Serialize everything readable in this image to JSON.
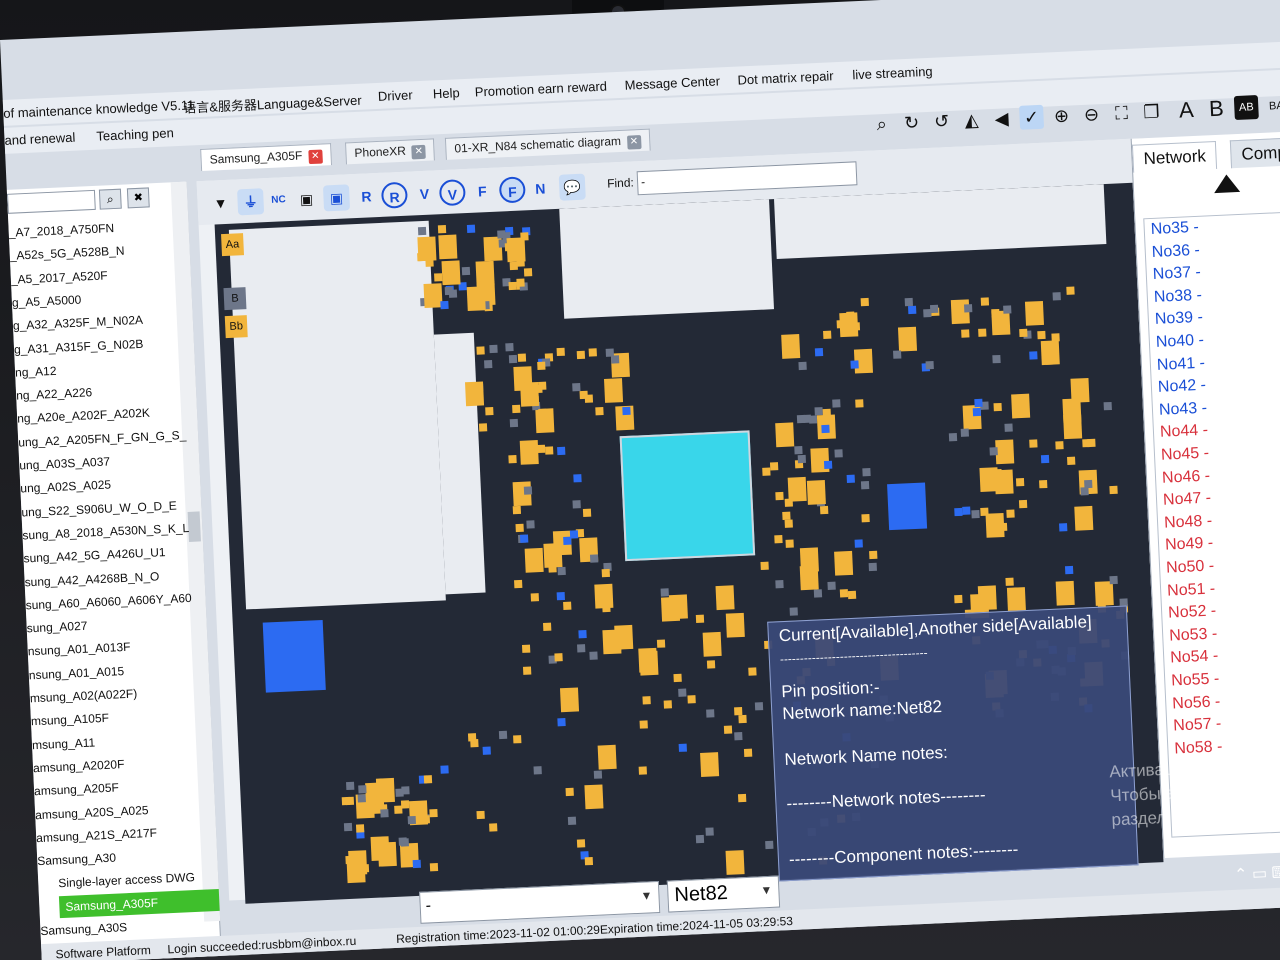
{
  "menu": {
    "title": "of maintenance knowledge V5.11",
    "items": [
      "Language&Server",
      "Driver",
      "Help",
      "Promotion earn reward",
      "Message Center",
      "Dot matrix repair",
      "live streaming"
    ],
    "lang_prefix": "语言&服务器",
    "row2": [
      "and renewal",
      "Teaching pen"
    ]
  },
  "tabs": [
    {
      "label": "Samsung_A305F"
    },
    {
      "label": "PhoneXR"
    },
    {
      "label": "01-XR_N84 schematic diagram"
    }
  ],
  "toolbar_letters": [
    "A",
    "B",
    "AB",
    "BA"
  ],
  "models": [
    "_A7_2018_A750FN",
    "_A52s_5G_A528B_N",
    "_A5_2017_A520F",
    "g_A5_A5000",
    "g_A32_A325F_M_N02A",
    "g_A31_A315F_G_N02B",
    "ng_A12",
    "ng_A22_A226",
    "ng_A20e_A202F_A202K",
    "ung_A2_A205FN_F_GN_G_S_",
    "ung_A03S_A037",
    "ung_A02S_A025",
    "ung_S22_S906U_W_O_D_E",
    "sung_A8_2018_A530N_S_K_L",
    "sung_A42_5G_A426U_U1",
    "sung_A42_A4268B_N_O",
    "sung_A60_A6060_A606Y_A60",
    "sung_A027",
    "nsung_A01_A013F",
    "nsung_A01_A015",
    "msung_A02(A022F)",
    "msung_A105F",
    "msung_A11",
    "amsung_A2020F",
    "amsung_A205F",
    "amsung_A20S_A025",
    "amsung_A21S_A217F",
    "Samsung_A30",
    "Single-layer access DWG",
    "Samsung_A305F",
    "Samsung_A30S"
  ],
  "find": {
    "label": "Find:",
    "value": "-"
  },
  "layer_buttons": [
    "Aa",
    "B",
    "Bb"
  ],
  "layer_icons": [
    "NC",
    "R",
    "R",
    "V",
    "V",
    "F",
    "F",
    "N"
  ],
  "right_tabs": [
    "Network",
    "Comp"
  ],
  "nets_blue": [
    "No35",
    "No36",
    "No37",
    "No38",
    "No39",
    "No40",
    "No41",
    "No42",
    "No43"
  ],
  "nets_red": [
    "No44",
    "No45",
    "No46",
    "No47",
    "No48",
    "No49",
    "No50",
    "No51",
    "No52",
    "No53",
    "No54",
    "No55",
    "No56",
    "No57",
    "No58"
  ],
  "net_suffix": "-",
  "tooltip": {
    "line1": "Current[Available],Another side[Available]",
    "line2": "-------------------------------------",
    "line3": "Pin position:-",
    "line4": "Network name:Net82",
    "line5": "Network Name notes:",
    "line6": "--------Network notes--------",
    "line7": "--------Component notes:--------"
  },
  "selectors": {
    "left": "-",
    "right": "Net82"
  },
  "status": {
    "platform": "Software Platform",
    "login": "Login succeeded:rusbbm@inbox.ru",
    "registration": "Registration time:2023-11-02 01:00:29Expiration time:2024-11-05 03:29:53"
  },
  "watermark": {
    "line1": "Активация Windows",
    "line2": "Чтобы активировать Wi",
    "line3": "раздел \"Параметры\"."
  },
  "colors": {
    "pad": "#f2b53c",
    "board": "#232936",
    "selected": "#3fbf2c",
    "net_blue": "#1a4fd6",
    "net_red": "#d8313c"
  }
}
